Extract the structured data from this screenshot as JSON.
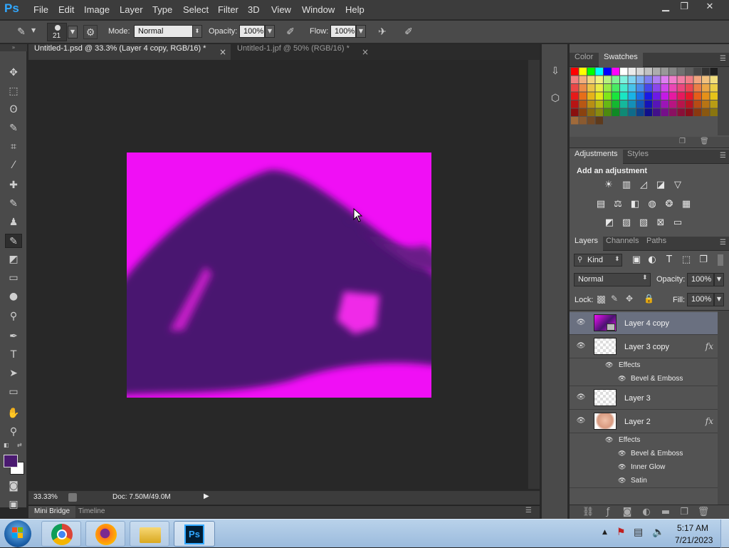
{
  "app": {
    "logo": "Ps"
  },
  "menu": [
    "File",
    "Edit",
    "Image",
    "Layer",
    "Type",
    "Select",
    "Filter",
    "3D",
    "View",
    "Window",
    "Help"
  ],
  "window_controls": {
    "minimize": "▁",
    "restore": "❐",
    "close": "✕"
  },
  "options": {
    "brush_size": "21",
    "mode_label": "Mode:",
    "mode_value": "Normal",
    "opacity_label": "Opacity:",
    "opacity_value": "100%",
    "flow_label": "Flow:",
    "flow_value": "100%"
  },
  "doc_tabs": [
    {
      "label": "Untitled-1.psd @ 33.3% (Layer 4 copy, RGB/16) *",
      "close": "×"
    },
    {
      "label": "Untitled-1.jpf @ 50% (RGB/16) *",
      "close": "×"
    }
  ],
  "status": {
    "zoom": "33.33%",
    "doc": "Doc: 7.50M/49.0M"
  },
  "bridge_tabs": [
    "Mini Bridge",
    "Timeline"
  ],
  "color_panel": {
    "tabs": [
      "Color",
      "Swatches"
    ]
  },
  "adjustments_panel": {
    "tabs": [
      "Adjustments",
      "Styles"
    ],
    "heading": "Add an adjustment"
  },
  "layers_panel": {
    "tabs": [
      "Layers",
      "Channels",
      "Paths"
    ],
    "filter_kind": "Kind",
    "blend_mode": "Normal",
    "opacity_label": "Opacity:",
    "opacity_value": "100%",
    "lock_label": "Lock:",
    "fill_label": "Fill:",
    "fill_value": "100%",
    "layers": [
      {
        "name": "Layer 4 copy",
        "selected": true
      },
      {
        "name": "Layer 3 copy",
        "fx": "fx",
        "effects_label": "Effects",
        "effects": [
          "Bevel & Emboss"
        ]
      },
      {
        "name": "Layer 3"
      },
      {
        "name": "Layer 2",
        "fx": "fx",
        "effects_label": "Effects",
        "effects": [
          "Bevel & Emboss",
          "Inner Glow",
          "Satin"
        ]
      }
    ]
  },
  "colors": {
    "foreground": "#4a1a70",
    "background": "#ffffff",
    "canvas_magenta": "#f00ff5",
    "canvas_purple": "#4a1470",
    "selected_layer": "#6a7080"
  },
  "taskbar": {
    "apps": [
      "windows-start",
      "chrome",
      "firefox",
      "file-explorer",
      "photoshop"
    ],
    "photoshop_label": "Ps",
    "time": "5:17 AM",
    "date": "7/21/2023"
  }
}
